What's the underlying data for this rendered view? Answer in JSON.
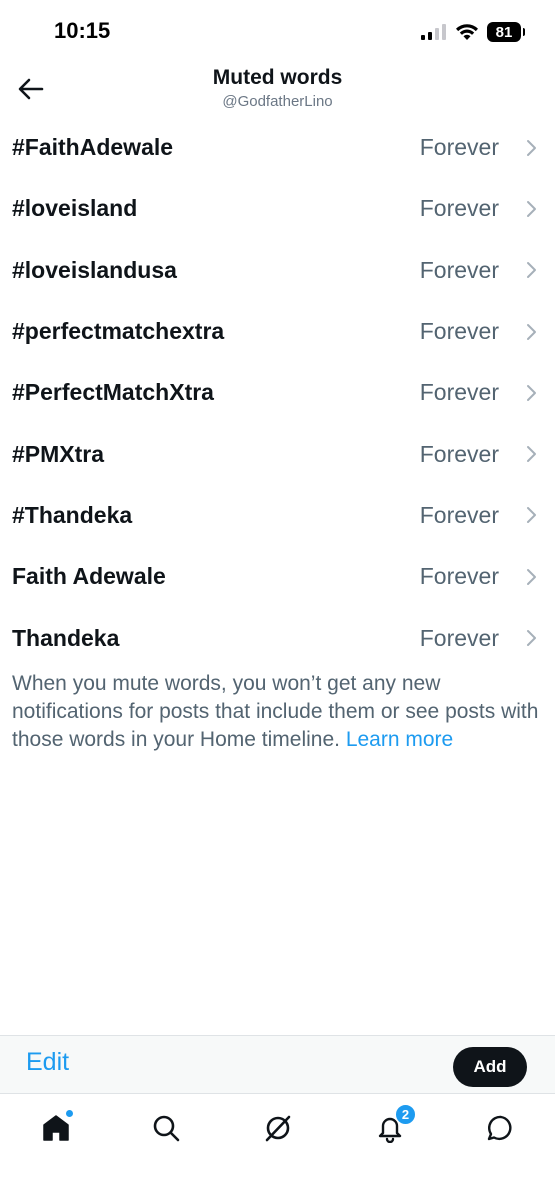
{
  "status_bar": {
    "time": "10:15",
    "battery": "81"
  },
  "header": {
    "title": "Muted words",
    "subtitle": "@GodfatherLino"
  },
  "muted_words": [
    {
      "word": "#FaithAdewale",
      "duration": "Forever"
    },
    {
      "word": "#loveisland",
      "duration": "Forever"
    },
    {
      "word": "#loveislandusa",
      "duration": "Forever"
    },
    {
      "word": "#perfectmatchextra",
      "duration": "Forever"
    },
    {
      "word": "#PerfectMatchXtra",
      "duration": "Forever"
    },
    {
      "word": "#PMXtra",
      "duration": "Forever"
    },
    {
      "word": "#Thandeka",
      "duration": "Forever"
    },
    {
      "word": "Faith Adewale",
      "duration": "Forever"
    },
    {
      "word": "Thandeka",
      "duration": "Forever"
    }
  ],
  "info": {
    "text": "When you mute words, you won’t get any new notifications for posts that include them or see posts with those words in your Home timeline.",
    "link": "Learn more"
  },
  "actions": {
    "edit_label": "Edit",
    "add_label": "Add"
  },
  "tab_bar": {
    "notifications_badge": "2",
    "icons": [
      "home-icon",
      "search-icon",
      "grok-icon",
      "bell-icon",
      "messages-icon"
    ]
  },
  "colors": {
    "accent": "#1d9bf0",
    "text_primary": "#0f1419",
    "text_secondary": "#536471",
    "button_dark": "#0f1419"
  }
}
